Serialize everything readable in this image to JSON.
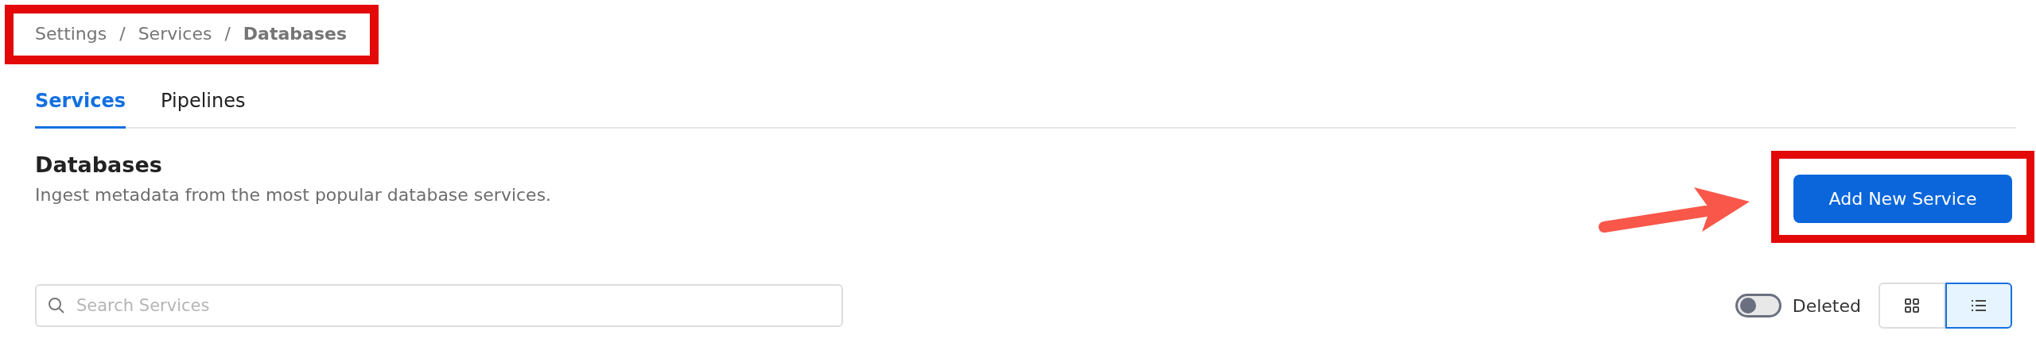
{
  "breadcrumb": {
    "items": [
      {
        "label": "Settings",
        "current": false
      },
      {
        "label": "Services",
        "current": false
      },
      {
        "label": "Databases",
        "current": true
      }
    ],
    "separator": "/",
    "highlighted": true
  },
  "tabs": [
    {
      "label": "Services",
      "selected": true
    },
    {
      "label": "Pipelines",
      "selected": false
    }
  ],
  "header": {
    "title": "Databases",
    "description": "Ingest metadata from the most popular database services.",
    "add_button": {
      "label": "Add New Service",
      "highlighted": true,
      "pointer_arrow": true
    }
  },
  "search": {
    "placeholder": "Search Services"
  },
  "deleted_toggle": {
    "label": "Deleted",
    "on": false
  },
  "view_switch": [
    {
      "kind": "grid",
      "selected": false
    },
    {
      "kind": "list",
      "selected": true
    }
  ]
}
